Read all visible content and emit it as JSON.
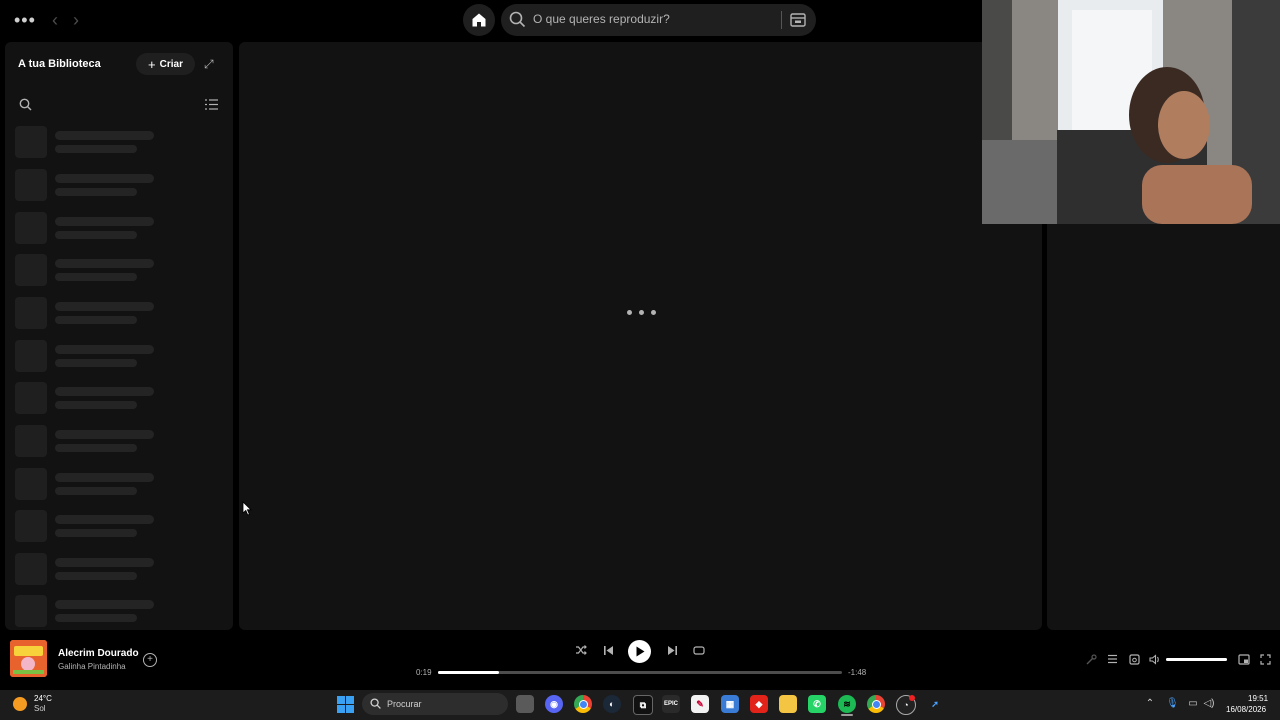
{
  "topbar": {
    "menu_icon": "more-dots-icon",
    "back_icon": "chevron-left-icon",
    "forward_icon": "chevron-right-icon",
    "home_icon": "home-icon",
    "search_placeholder": "O que queres reproduzir?",
    "browse_icon": "browse-icon"
  },
  "library": {
    "title": "A tua Biblioteca",
    "create_label": "Criar",
    "expand_icon": "expand-icon",
    "search_icon": "search-icon",
    "list_icon": "list-view-icon",
    "skeleton_rows": 12
  },
  "main": {
    "loading_indicator": "loading-dots"
  },
  "player": {
    "track_title": "Alecrim Dourado",
    "track_artist": "Galinha Pintadinha",
    "elapsed": "0:19",
    "remaining": "-1:48",
    "progress_fraction": 0.15,
    "volume_fraction": 1.0,
    "is_playing": false,
    "shuffle_icon": "shuffle-icon",
    "prev_icon": "previous-icon",
    "play_icon": "play-icon",
    "next_icon": "next-icon",
    "repeat_icon": "repeat-icon",
    "accent": "#1db954"
  },
  "taskbar": {
    "weather_temp": "24°C",
    "weather_condition": "Sol",
    "search_placeholder": "Procurar",
    "time": "19:51",
    "date": "16/08/2026",
    "apps": [
      "task-view",
      "discord",
      "chrome",
      "steam",
      "capcut",
      "epic-games",
      "paint",
      "store",
      "anydesk",
      "file-explorer",
      "whatsapp",
      "spotify",
      "chrome-profile",
      "obs",
      "app"
    ]
  }
}
